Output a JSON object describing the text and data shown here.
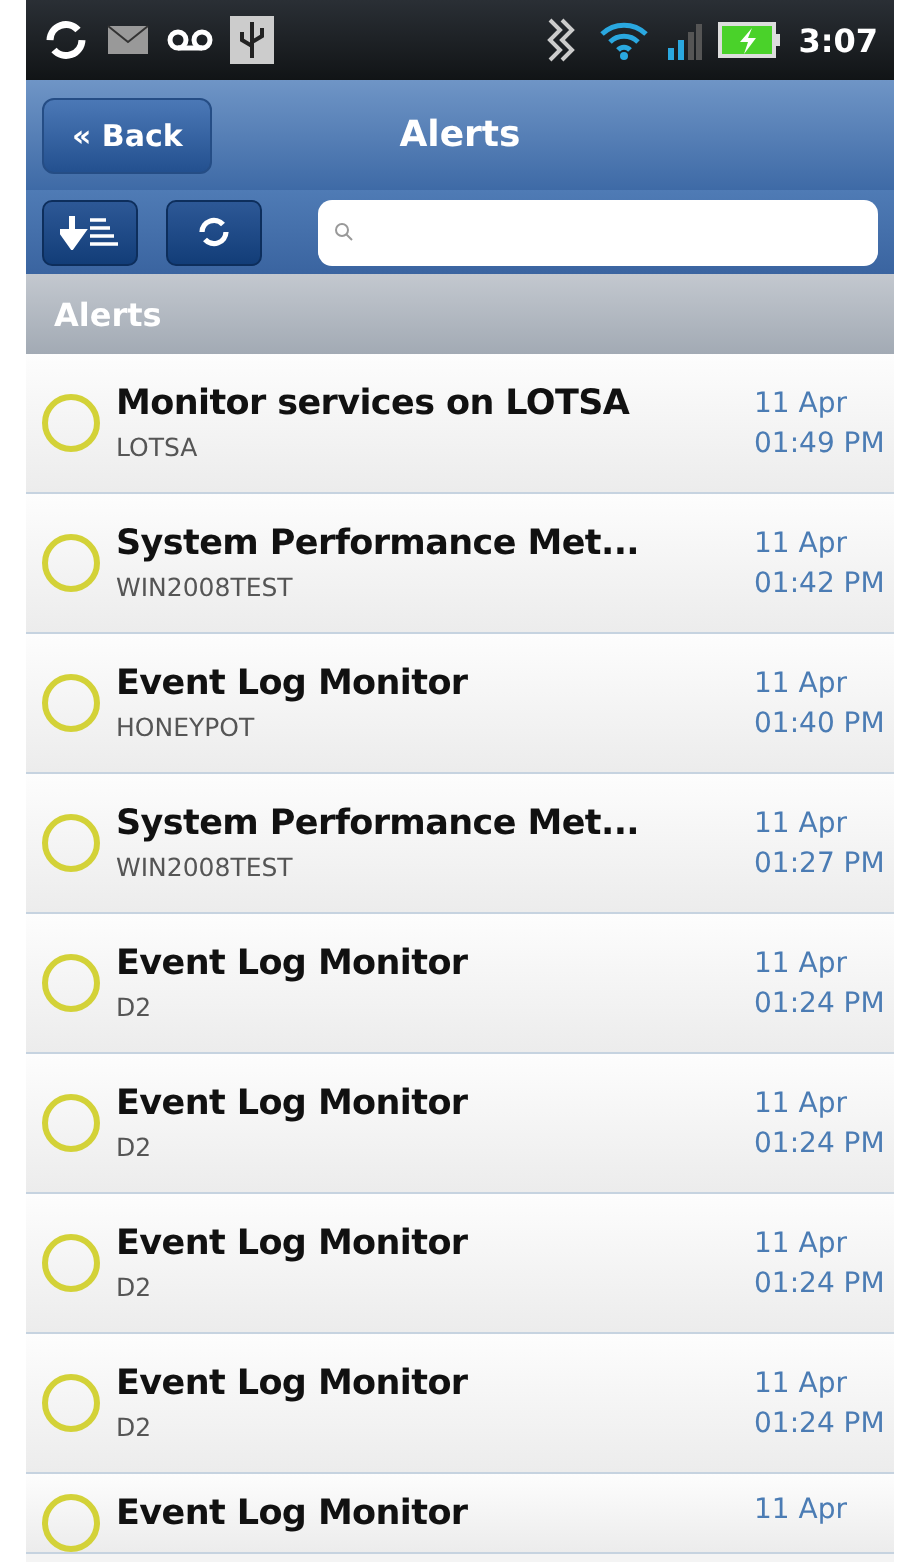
{
  "status_bar": {
    "time": "3:07"
  },
  "header": {
    "back_label": "« Back",
    "title": "Alerts"
  },
  "section": {
    "title": "Alerts"
  },
  "alerts": [
    {
      "title": "Monitor services on LOTSA",
      "source": "LOTSA",
      "date": "11 Apr",
      "time": "01:49 PM"
    },
    {
      "title": "System Performance Met...",
      "source": "WIN2008TEST",
      "date": "11 Apr",
      "time": "01:42 PM"
    },
    {
      "title": "Event Log Monitor",
      "source": "HONEYPOT",
      "date": "11 Apr",
      "time": "01:40 PM"
    },
    {
      "title": "System Performance Met...",
      "source": "WIN2008TEST",
      "date": "11 Apr",
      "time": "01:27 PM"
    },
    {
      "title": "Event Log Monitor",
      "source": "D2",
      "date": "11 Apr",
      "time": "01:24 PM"
    },
    {
      "title": "Event Log Monitor",
      "source": "D2",
      "date": "11 Apr",
      "time": "01:24 PM"
    },
    {
      "title": "Event Log Monitor",
      "source": "D2",
      "date": "11 Apr",
      "time": "01:24 PM"
    },
    {
      "title": "Event Log Monitor",
      "source": "D2",
      "date": "11 Apr",
      "time": "01:24 PM"
    },
    {
      "title": "Event Log Monitor",
      "date": "11 Apr"
    }
  ]
}
